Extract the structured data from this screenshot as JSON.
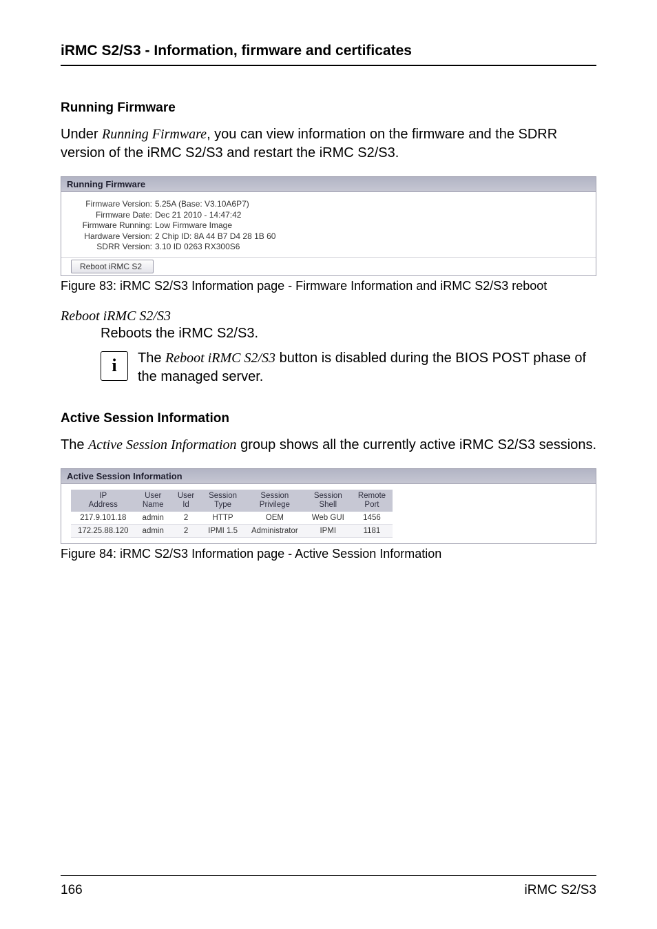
{
  "header": {
    "title": "iRMC S2/S3 - Information, firmware and certificates"
  },
  "sec1": {
    "heading": "Running Firmware",
    "para_before_italic": "Under ",
    "para_italic": "Running Firmware",
    "para_after_italic": ", you can view information on the firmware and the SDRR version of the iRMC S2/S3 and restart the iRMC S2/S3."
  },
  "rf_panel": {
    "title": "Running Firmware",
    "rows": [
      {
        "label": "Firmware Version:",
        "value": "5.25A (Base: V3.10A6P7)"
      },
      {
        "label": "Firmware Date:",
        "value": "Dec 21 2010 - 14:47:42"
      },
      {
        "label": "Firmware Running:",
        "value": "Low Firmware Image"
      },
      {
        "label": "Hardware Version:",
        "value": "2 Chip ID: 8A 44 B7 D4 28 1B 60"
      },
      {
        "label": "SDRR Version:",
        "value": "3.10 ID 0263 RX300S6"
      }
    ],
    "button_label": "Reboot iRMC S2"
  },
  "fig1_caption": "Figure 83: iRMC S2/S3 Information page - Firmware Information and iRMC S2/S3 reboot",
  "dlist": {
    "term": "Reboot iRMC S2/S3",
    "def": "Reboots the iRMC S2/S3."
  },
  "info": {
    "glyph": "i",
    "pre": "The ",
    "italic": "Reboot iRMC S2/S3",
    "post": " button is disabled during the BIOS POST phase of the managed server."
  },
  "sec2": {
    "heading": "Active Session Information",
    "para_pre": "The ",
    "para_italic": "Active Session Information",
    "para_post": " group shows all the currently active iRMC S2/S3 sessions."
  },
  "asi_panel": {
    "title": "Active Session Information",
    "headers": [
      "IP\nAddress",
      "User\nName",
      "User\nId",
      "Session\nType",
      "Session\nPrivilege",
      "Session\nShell",
      "Remote\nPort"
    ],
    "rows": [
      [
        "217.9.101.18",
        "admin",
        "2",
        "HTTP",
        "OEM",
        "Web GUI",
        "1456"
      ],
      [
        "172.25.88.120",
        "admin",
        "2",
        "IPMI 1.5",
        "Administrator",
        "IPMI",
        "1181"
      ]
    ]
  },
  "fig2_caption": "Figure 84: iRMC S2/S3 Information page - Active Session Information",
  "footer": {
    "page": "166",
    "product": "iRMC S2/S3"
  }
}
